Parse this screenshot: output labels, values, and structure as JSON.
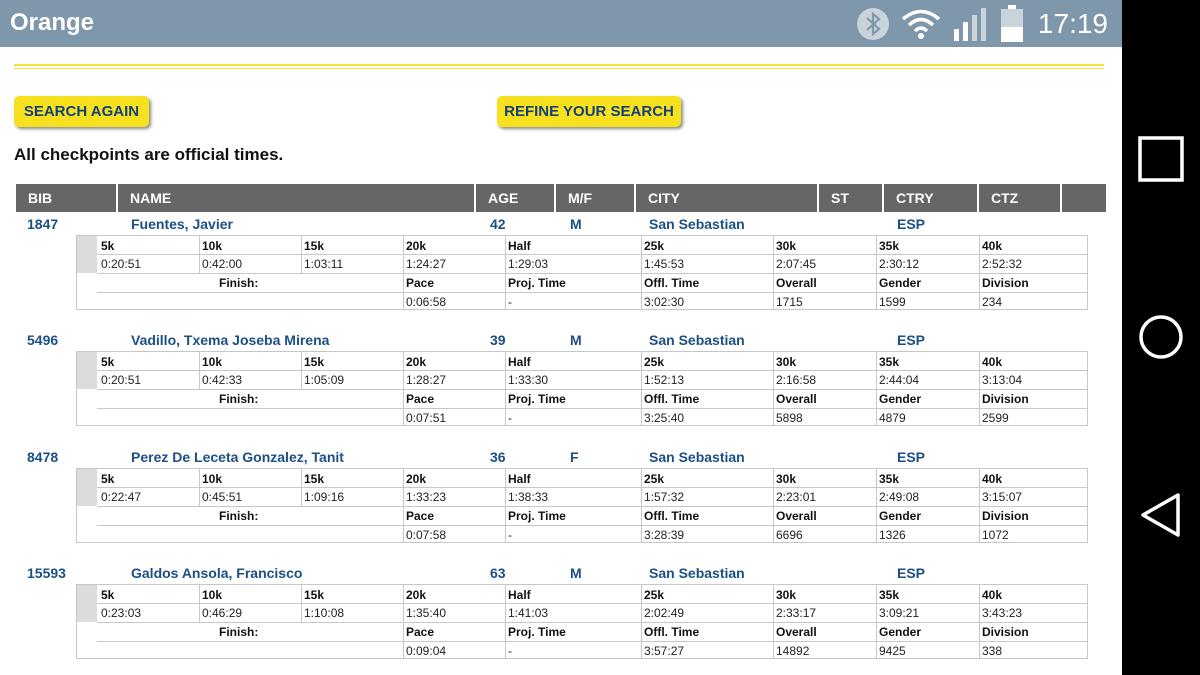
{
  "status_bar": {
    "app_title": "Orange",
    "clock": "17:19"
  },
  "buttons": {
    "search_again": "SEARCH AGAIN",
    "refine": "REFINE YOUR SEARCH"
  },
  "notice": "All checkpoints are official times.",
  "columns": [
    "BIB",
    "NAME",
    "AGE",
    "M/F",
    "CITY",
    "ST",
    "CTRY",
    "CTZ"
  ],
  "split_labels": [
    "5k",
    "10k",
    "15k",
    "20k",
    "Half",
    "25k",
    "30k",
    "35k",
    "40k"
  ],
  "finish_labels": {
    "finish": "Finish:",
    "pace": "Pace",
    "proj_time": "Proj. Time",
    "offl_time": "Offl. Time",
    "overall": "Overall",
    "gender": "Gender",
    "division": "Division"
  },
  "runners": [
    {
      "bib": "1847",
      "name": "Fuentes, Javier",
      "age": "42",
      "sex": "M",
      "city": "San Sebastian",
      "st": "",
      "ctry": "ESP",
      "ctz": "",
      "splits": [
        "0:20:51",
        "0:42:00",
        "1:03:11",
        "1:24:27",
        "1:29:03",
        "1:45:53",
        "2:07:45",
        "2:30:12",
        "2:52:32"
      ],
      "pace": "0:06:58",
      "proj_time": "-",
      "offl_time": "3:02:30",
      "overall": "1715",
      "gender": "1599",
      "division": "234"
    },
    {
      "bib": "5496",
      "name": "Vadillo, Txema Joseba Mirena",
      "age": "39",
      "sex": "M",
      "city": "San Sebastian",
      "st": "",
      "ctry": "ESP",
      "ctz": "",
      "splits": [
        "0:20:51",
        "0:42:33",
        "1:05:09",
        "1:28:27",
        "1:33:30",
        "1:52:13",
        "2:16:58",
        "2:44:04",
        "3:13:04"
      ],
      "pace": "0:07:51",
      "proj_time": "-",
      "offl_time": "3:25:40",
      "overall": "5898",
      "gender": "4879",
      "division": "2599"
    },
    {
      "bib": "8478",
      "name": "Perez De Leceta Gonzalez, Tanit",
      "age": "36",
      "sex": "F",
      "city": "San Sebastian",
      "st": "",
      "ctry": "ESP",
      "ctz": "",
      "splits": [
        "0:22:47",
        "0:45:51",
        "1:09:16",
        "1:33:23",
        "1:38:33",
        "1:57:32",
        "2:23:01",
        "2:49:08",
        "3:15:07"
      ],
      "pace": "0:07:58",
      "proj_time": "-",
      "offl_time": "3:28:39",
      "overall": "6696",
      "gender": "1326",
      "division": "1072"
    },
    {
      "bib": "15593",
      "name": "Galdos Ansola, Francisco",
      "age": "63",
      "sex": "M",
      "city": "San Sebastian",
      "st": "",
      "ctry": "ESP",
      "ctz": "",
      "splits": [
        "0:23:03",
        "0:46:29",
        "1:10:08",
        "1:35:40",
        "1:41:03",
        "2:02:49",
        "2:33:17",
        "3:09:21",
        "3:43:23"
      ],
      "pace": "0:09:04",
      "proj_time": "-",
      "offl_time": "3:57:27",
      "overall": "14892",
      "gender": "9425",
      "division": "338"
    }
  ],
  "colors": {
    "status_bar": "#7f97aa",
    "button": "#f7e11f",
    "button_text": "#13407a",
    "header": "#666666",
    "link": "#1b4f86",
    "divider": "#f2e23a"
  },
  "icons": [
    "bluetooth-icon",
    "wifi-icon",
    "signal-icon",
    "battery-icon",
    "recents-square-icon",
    "home-circle-icon",
    "back-triangle-icon"
  ]
}
